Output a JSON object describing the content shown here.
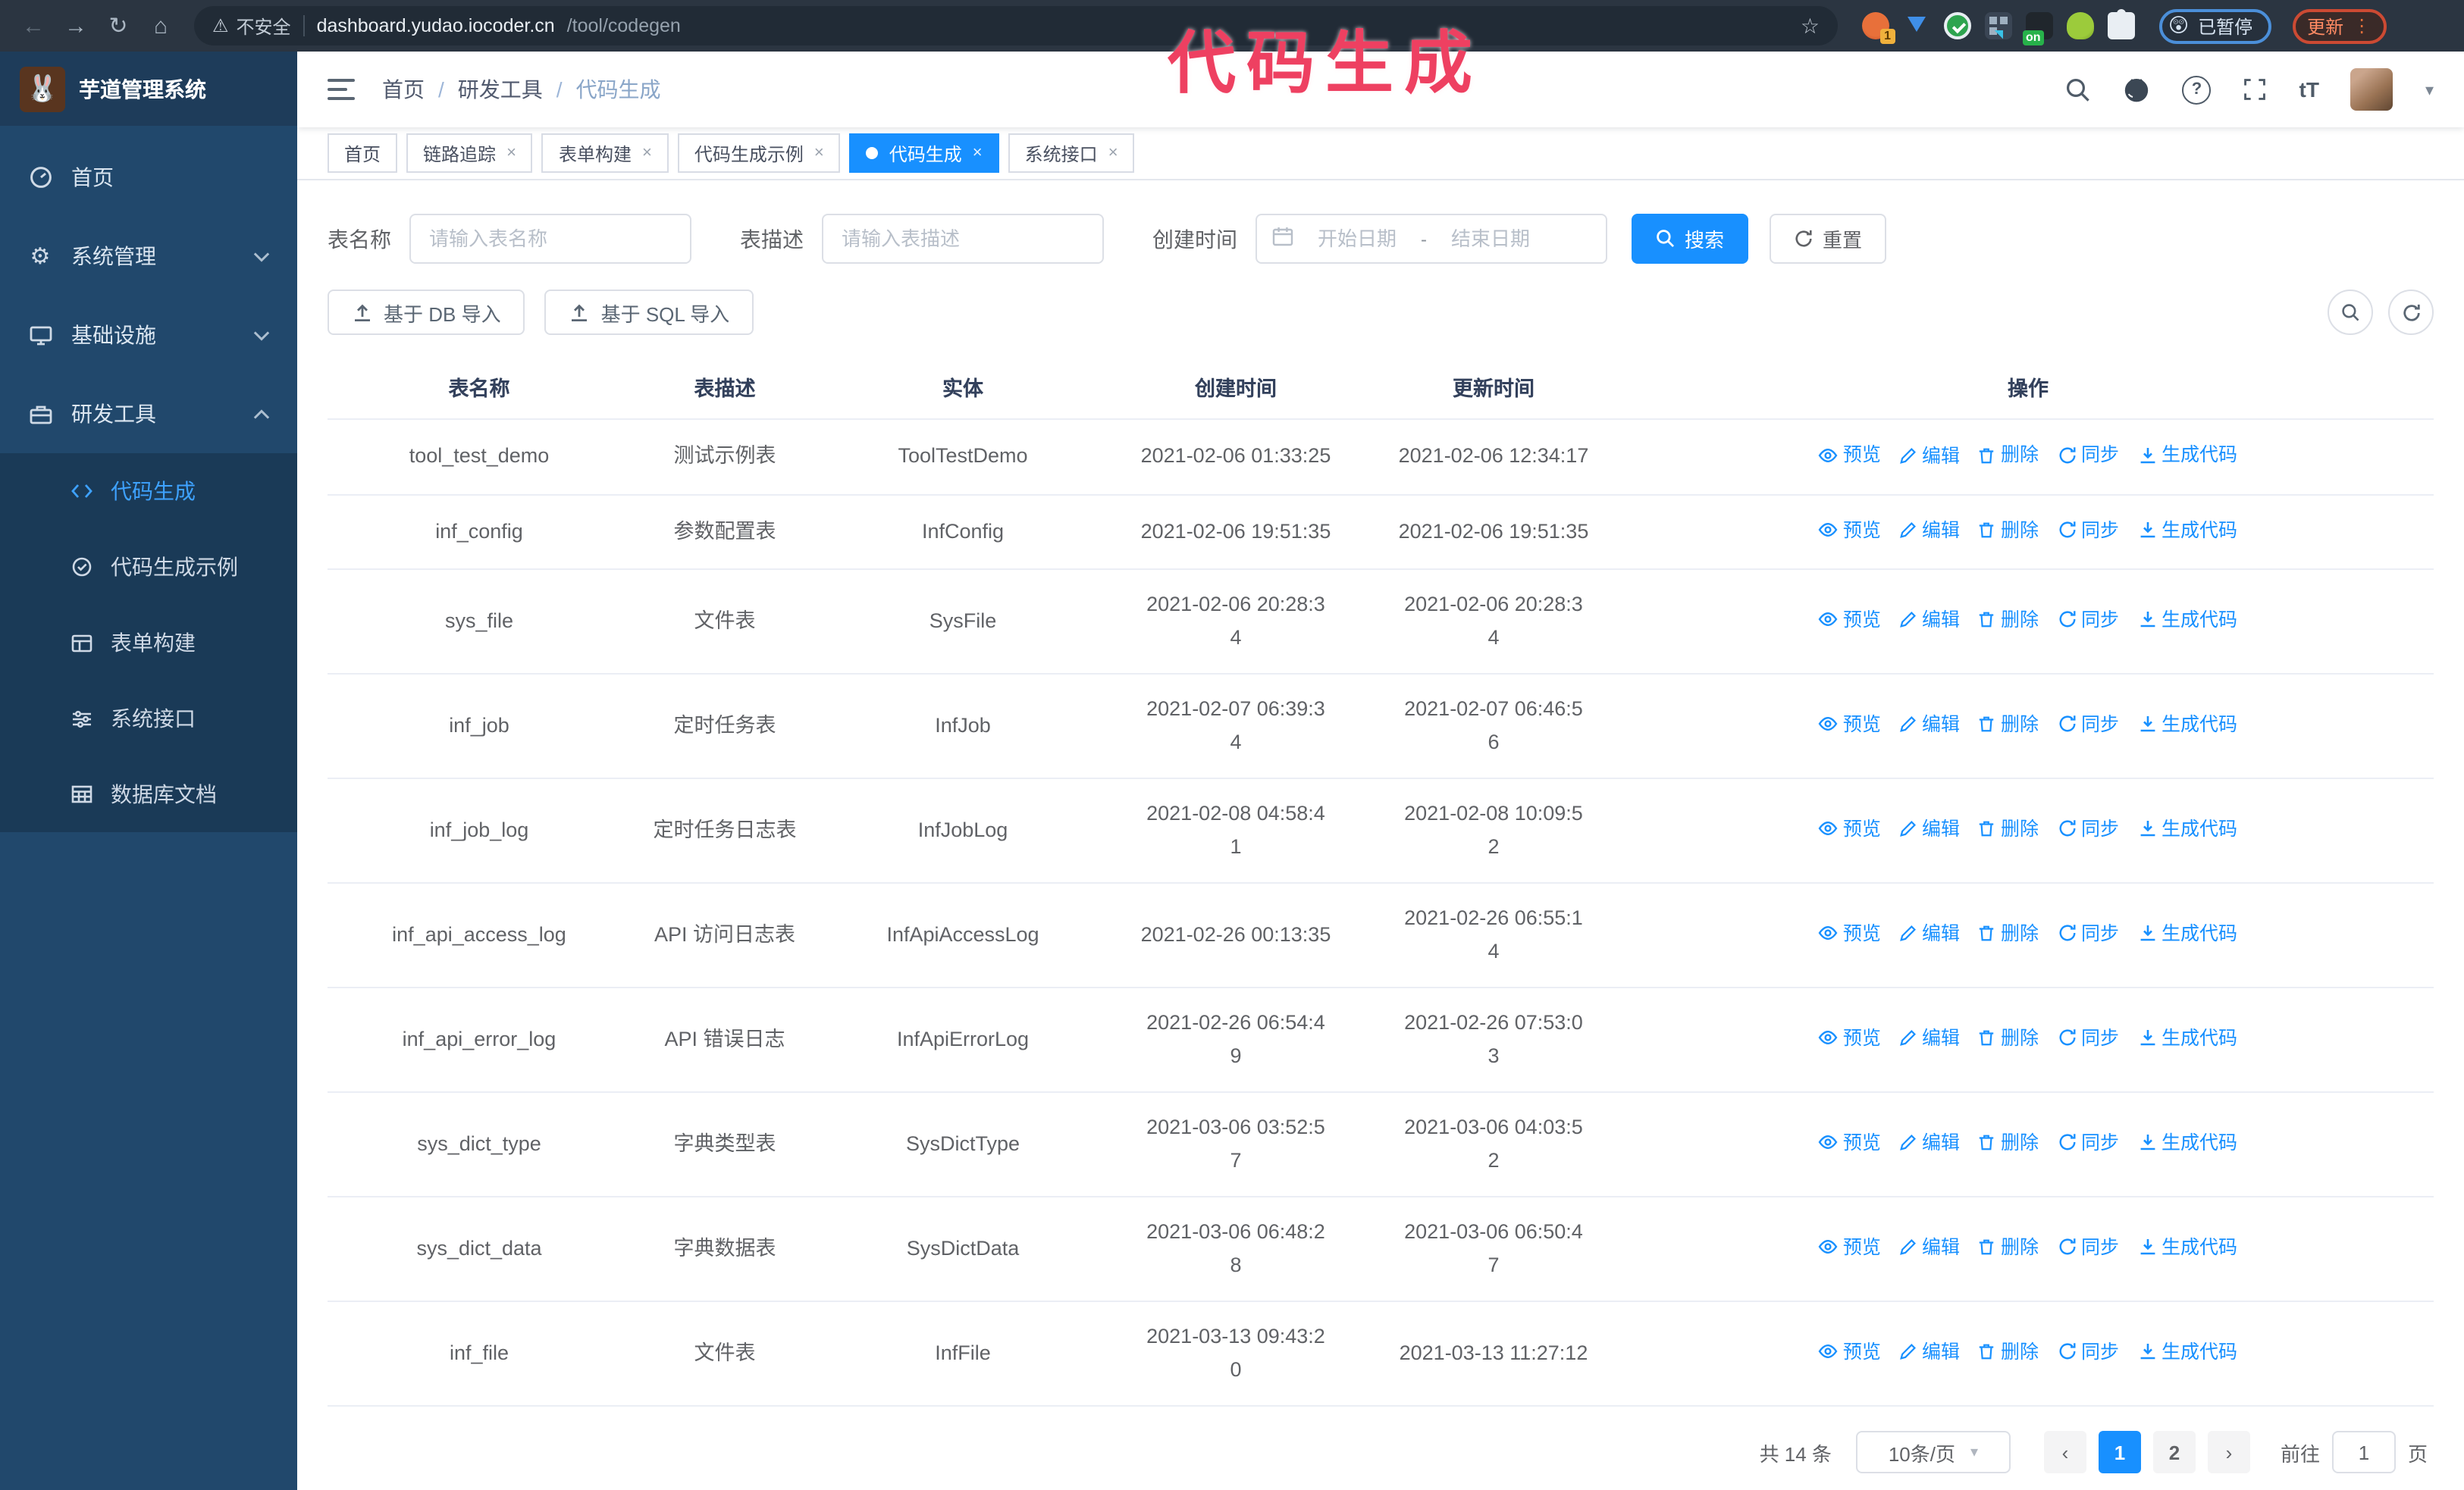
{
  "annotation": {
    "text": "代码生成",
    "color": "#ee4061"
  },
  "browser": {
    "security_label": "不安全",
    "url_host": "dashboard.yudao.iocoder.cn",
    "url_path": "/tool/codegen",
    "paused_badge": "已暂停",
    "update_button": "更新",
    "extension_badge": "1",
    "extension_on": "on"
  },
  "icons": {
    "back": "←",
    "forward": "→",
    "reload": "↻",
    "home": "⌂",
    "warning": "⚠",
    "star": "☆",
    "gear": "⚙",
    "caret": "▾",
    "dots": "⋮",
    "close": "×",
    "question": "?",
    "text_size": "tT",
    "prev": "‹",
    "next": "›",
    "paused_emoji": "😲",
    "logo_emoji": "🐰",
    "range_separator": "-"
  },
  "sidebar": {
    "logo_title": "芋道管理系统",
    "items": [
      {
        "label": "首页"
      },
      {
        "label": "系统管理"
      },
      {
        "label": "基础设施"
      },
      {
        "label": "研发工具"
      }
    ],
    "submenu": [
      {
        "label": "代码生成"
      },
      {
        "label": "代码生成示例"
      },
      {
        "label": "表单构建"
      },
      {
        "label": "系统接口"
      },
      {
        "label": "数据库文档"
      }
    ]
  },
  "breadcrumb": {
    "items": [
      "首页",
      "研发工具",
      "代码生成"
    ],
    "separator": "/"
  },
  "tabs": [
    {
      "label": "首页",
      "closable": false,
      "active": false
    },
    {
      "label": "链路追踪",
      "closable": true,
      "active": false
    },
    {
      "label": "表单构建",
      "closable": true,
      "active": false
    },
    {
      "label": "代码生成示例",
      "closable": true,
      "active": false
    },
    {
      "label": "代码生成",
      "closable": true,
      "active": true
    },
    {
      "label": "系统接口",
      "closable": true,
      "active": false
    }
  ],
  "filters": {
    "name_label": "表名称",
    "name_placeholder": "请输入表名称",
    "desc_label": "表描述",
    "desc_placeholder": "请输入表描述",
    "time_label": "创建时间",
    "start_placeholder": "开始日期",
    "end_placeholder": "结束日期",
    "search_button": "搜索",
    "reset_button": "重置"
  },
  "toolbar": {
    "import_db": "基于 DB 导入",
    "import_sql": "基于 SQL 导入"
  },
  "table": {
    "columns": [
      "表名称",
      "表描述",
      "实体",
      "创建时间",
      "更新时间",
      "操作"
    ],
    "actions": [
      "预览",
      "编辑",
      "删除",
      "同步",
      "生成代码"
    ],
    "rows": [
      {
        "name": "tool_test_demo",
        "desc": "测试示例表",
        "entity": "ToolTestDemo",
        "created": "2021-02-06 01:33:25",
        "updated": "2021-02-06 12:34:17"
      },
      {
        "name": "inf_config",
        "desc": "参数配置表",
        "entity": "InfConfig",
        "created": "2021-02-06 19:51:35",
        "updated": "2021-02-06 19:51:35"
      },
      {
        "name": "sys_file",
        "desc": "文件表",
        "entity": "SysFile",
        "created": "2021-02-06 20:28:3\n4",
        "updated": "2021-02-06 20:28:3\n4"
      },
      {
        "name": "inf_job",
        "desc": "定时任务表",
        "entity": "InfJob",
        "created": "2021-02-07 06:39:3\n4",
        "updated": "2021-02-07 06:46:5\n6"
      },
      {
        "name": "inf_job_log",
        "desc": "定时任务日志表",
        "entity": "InfJobLog",
        "created": "2021-02-08 04:58:4\n1",
        "updated": "2021-02-08 10:09:5\n2"
      },
      {
        "name": "inf_api_access_log",
        "desc": "API 访问日志表",
        "entity": "InfApiAccessLog",
        "created": "2021-02-26 00:13:35",
        "updated": "2021-02-26 06:55:1\n4"
      },
      {
        "name": "inf_api_error_log",
        "desc": "API 错误日志",
        "entity": "InfApiErrorLog",
        "created": "2021-02-26 06:54:4\n9",
        "updated": "2021-02-26 07:53:0\n3"
      },
      {
        "name": "sys_dict_type",
        "desc": "字典类型表",
        "entity": "SysDictType",
        "created": "2021-03-06 03:52:5\n7",
        "updated": "2021-03-06 04:03:5\n2"
      },
      {
        "name": "sys_dict_data",
        "desc": "字典数据表",
        "entity": "SysDictData",
        "created": "2021-03-06 06:48:2\n8",
        "updated": "2021-03-06 06:50:4\n7"
      },
      {
        "name": "inf_file",
        "desc": "文件表",
        "entity": "InfFile",
        "created": "2021-03-13 09:43:2\n0",
        "updated": "2021-03-13 11:27:12"
      }
    ]
  },
  "pagination": {
    "total": "共 14 条",
    "page_size": "10条/页",
    "pages": [
      "1",
      "2"
    ],
    "goto_label": "前往",
    "goto_value": "1",
    "page_unit": "页"
  }
}
